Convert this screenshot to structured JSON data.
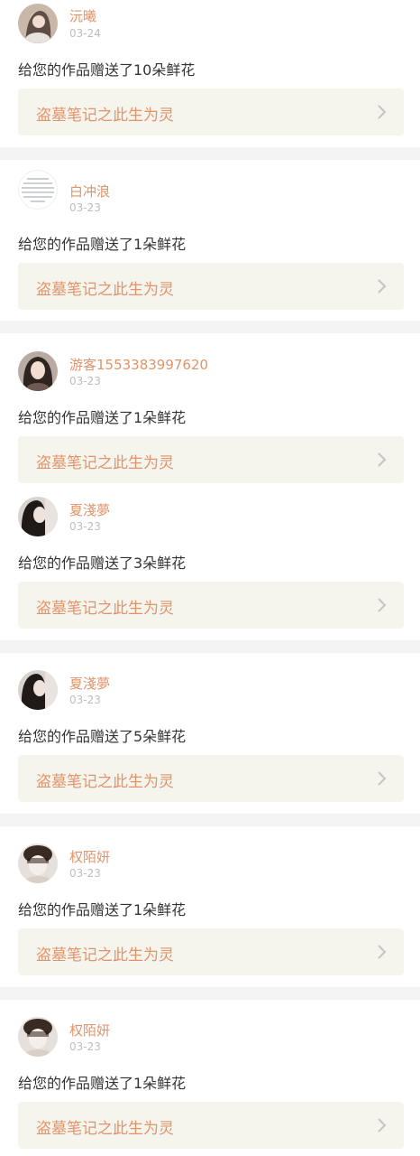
{
  "colors": {
    "accent": "#e0946a",
    "date": "#bdbdbd",
    "text": "#333333",
    "link_bg": "#f5f5ee",
    "divider": "#f4f4f4"
  },
  "notifications": [
    {
      "user": "沅曦",
      "date": "03-24",
      "message": "给您的作品赠送了10朵鲜花",
      "work_title": "盗墓笔记之此生为灵",
      "avatar": "avatar-photo-icon"
    },
    {
      "user": "白冲浪",
      "date": "03-23",
      "message": "给您的作品赠送了1朵鲜花",
      "work_title": "盗墓笔记之此生为灵",
      "avatar": "avatar-text-image-icon"
    },
    {
      "user": "游客1553383997620",
      "date": "03-23",
      "message": "给您的作品赠送了1朵鲜花",
      "work_title": "盗墓笔记之此生为灵",
      "avatar": "avatar-photo-icon"
    },
    {
      "user": "夏淺夢",
      "date": "03-23",
      "message": "给您的作品赠送了3朵鲜花",
      "work_title": "盗墓笔记之此生为灵",
      "avatar": "avatar-photo-icon"
    },
    {
      "user": "夏淺夢",
      "date": "03-23",
      "message": "给您的作品赠送了5朵鲜花",
      "work_title": "盗墓笔记之此生为灵",
      "avatar": "avatar-photo-icon"
    },
    {
      "user": "权陌妍",
      "date": "03-23",
      "message": "给您的作品赠送了1朵鲜花",
      "work_title": "盗墓笔记之此生为灵",
      "avatar": "avatar-photo-icon"
    },
    {
      "user": "权陌妍",
      "date": "03-23",
      "message": "给您的作品赠送了1朵鲜花",
      "work_title": "盗墓笔记之此生为灵",
      "avatar": "avatar-photo-icon"
    }
  ]
}
